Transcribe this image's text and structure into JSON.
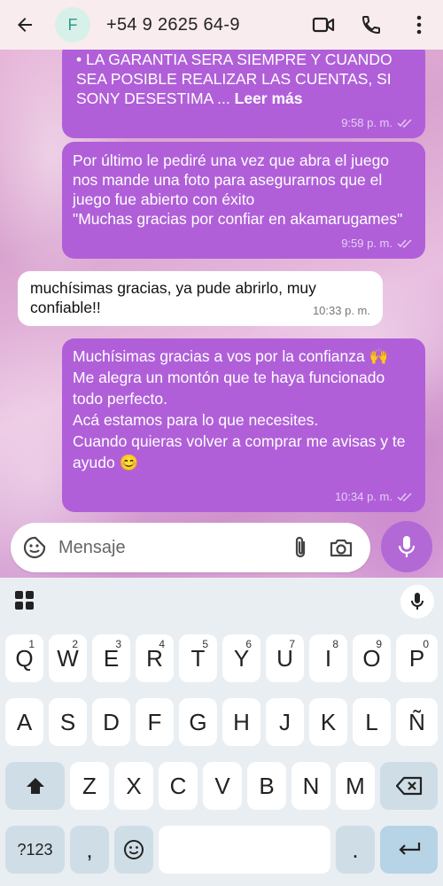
{
  "header": {
    "back_icon": "arrow-left-icon",
    "avatar_letter": "F",
    "contact_name": "+54 9 2625 64-9",
    "actions": [
      "video-call-icon",
      "phone-icon",
      "more-vert-icon"
    ]
  },
  "messages": [
    {
      "dir": "out",
      "text": "• LA GARANTIA SERA SIEMPRE Y CUANDO SEA POSIBLE REALIZAR LAS CUENTAS, SI SONY DESESTIMA ...",
      "read_more": "Leer más",
      "time": "9:58 p. m."
    },
    {
      "dir": "out",
      "text": "Por último le pediré una vez que abra el juego nos mande una foto para asegurarnos que el juego fue abierto con éxito\n\"Muchas gracias por confiar en akamarugames\"",
      "time": "9:59 p. m."
    },
    {
      "dir": "in",
      "text": "muchísimas gracias, ya pude abrirlo, muy confiable!!",
      "time": "10:33 p. m."
    },
    {
      "dir": "out",
      "text": "Muchísimas gracias a vos por la confianza 🙌\nMe alegra un montón que te haya funcionado todo perfecto.\nAcá estamos para lo que necesites.\nCuando quieras volver a comprar me avisas y te ayudo 😊",
      "time": "10:34 p. m."
    }
  ],
  "composer": {
    "placeholder": "Mensaje"
  },
  "keyboard": {
    "row1": [
      {
        "k": "Q",
        "n": "1"
      },
      {
        "k": "W",
        "n": "2"
      },
      {
        "k": "E",
        "n": "3"
      },
      {
        "k": "R",
        "n": "4"
      },
      {
        "k": "T",
        "n": "5"
      },
      {
        "k": "Y",
        "n": "6"
      },
      {
        "k": "U",
        "n": "7"
      },
      {
        "k": "I",
        "n": "8"
      },
      {
        "k": "O",
        "n": "9"
      },
      {
        "k": "P",
        "n": "0"
      }
    ],
    "row2": [
      "A",
      "S",
      "D",
      "F",
      "G",
      "H",
      "J",
      "K",
      "L",
      "Ñ"
    ],
    "row3": [
      "Z",
      "X",
      "C",
      "V",
      "B",
      "N",
      "M"
    ],
    "symbols": "?123",
    "comma": ",",
    "period": "."
  }
}
